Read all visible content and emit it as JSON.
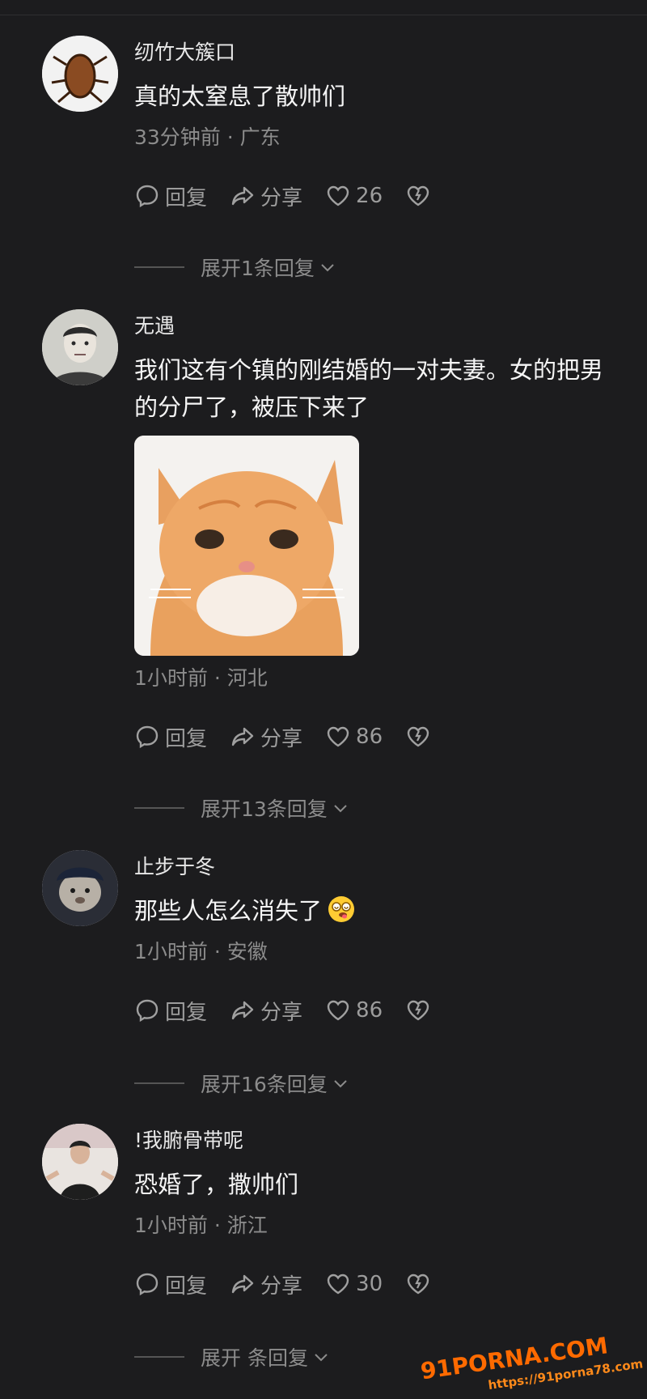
{
  "comments": [
    {
      "username": "纫竹大簇口",
      "text": "真的太窒息了散帅们",
      "meta": "33分钟前 · 广东",
      "reply_label": "回复",
      "share_label": "分享",
      "likes": "26",
      "expand_label": "展开1条回复"
    },
    {
      "username": "无遇",
      "text": "我们这有个镇的刚结婚的一对夫妻。女的把男的分尸了，被压下来了",
      "meta": "1小时前 · 河北",
      "reply_label": "回复",
      "share_label": "分享",
      "likes": "86",
      "expand_label": "展开13条回复"
    },
    {
      "username": "止步于冬",
      "text": "那些人怎么消失了",
      "meta": "1小时前 · 安徽",
      "reply_label": "回复",
      "share_label": "分享",
      "likes": "86",
      "expand_label": "展开16条回复"
    },
    {
      "username": "!我腑骨带呢",
      "text": "恐婚了，撒帅们",
      "meta": "1小时前 · 浙江",
      "reply_label": "回复",
      "share_label": "分享",
      "likes": "30",
      "expand_label": "展开 条回复"
    }
  ],
  "watermark": {
    "main": "91PORNA.COM",
    "sub": "https://91porna78.com"
  },
  "colors": {
    "background": "#1c1c1e",
    "text_primary": "#f5f5f5",
    "text_secondary": "#8c8c8c",
    "watermark": "#ff6a00"
  },
  "icons": [
    "comment-bubble-icon",
    "share-arrow-icon",
    "heart-icon",
    "broken-heart-icon",
    "chevron-down-icon"
  ]
}
